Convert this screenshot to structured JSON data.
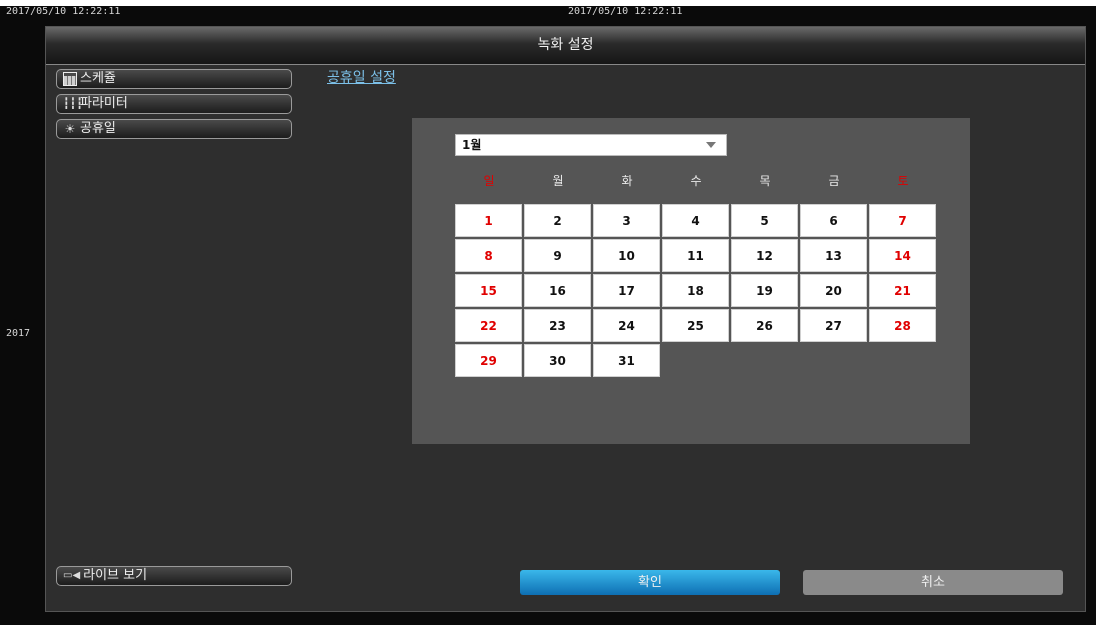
{
  "timestamps": {
    "top_left": "2017/05/10 12:22:11",
    "top_center": "2017/05/10 12:22:11",
    "side": "2017"
  },
  "window": {
    "title": "녹화 설정"
  },
  "sidebar": {
    "items": [
      {
        "label": "스케쥴",
        "icon": "calendar-icon"
      },
      {
        "label": "파라미터",
        "icon": "sliders-icon"
      },
      {
        "label": "공휴일",
        "icon": "holiday-icon"
      }
    ],
    "live_button": {
      "label": "라이브 보기",
      "icon": "live-view-icon"
    }
  },
  "section": {
    "title": "공휴일 설정"
  },
  "calendar": {
    "month": "1월",
    "weekdays": [
      "일",
      "월",
      "화",
      "수",
      "목",
      "금",
      "토"
    ],
    "weeks": [
      [
        "1",
        "2",
        "3",
        "4",
        "5",
        "6",
        "7"
      ],
      [
        "8",
        "9",
        "10",
        "11",
        "12",
        "13",
        "14"
      ],
      [
        "15",
        "16",
        "17",
        "18",
        "19",
        "20",
        "21"
      ],
      [
        "22",
        "23",
        "24",
        "25",
        "26",
        "27",
        "28"
      ],
      [
        "29",
        "30",
        "31"
      ]
    ],
    "holiday_color": "#e00000"
  },
  "buttons": {
    "ok": "확인",
    "cancel": "취소"
  },
  "colors": {
    "accent": "#1a8fd0",
    "link": "#7cc0e8",
    "panel": "#555555"
  }
}
